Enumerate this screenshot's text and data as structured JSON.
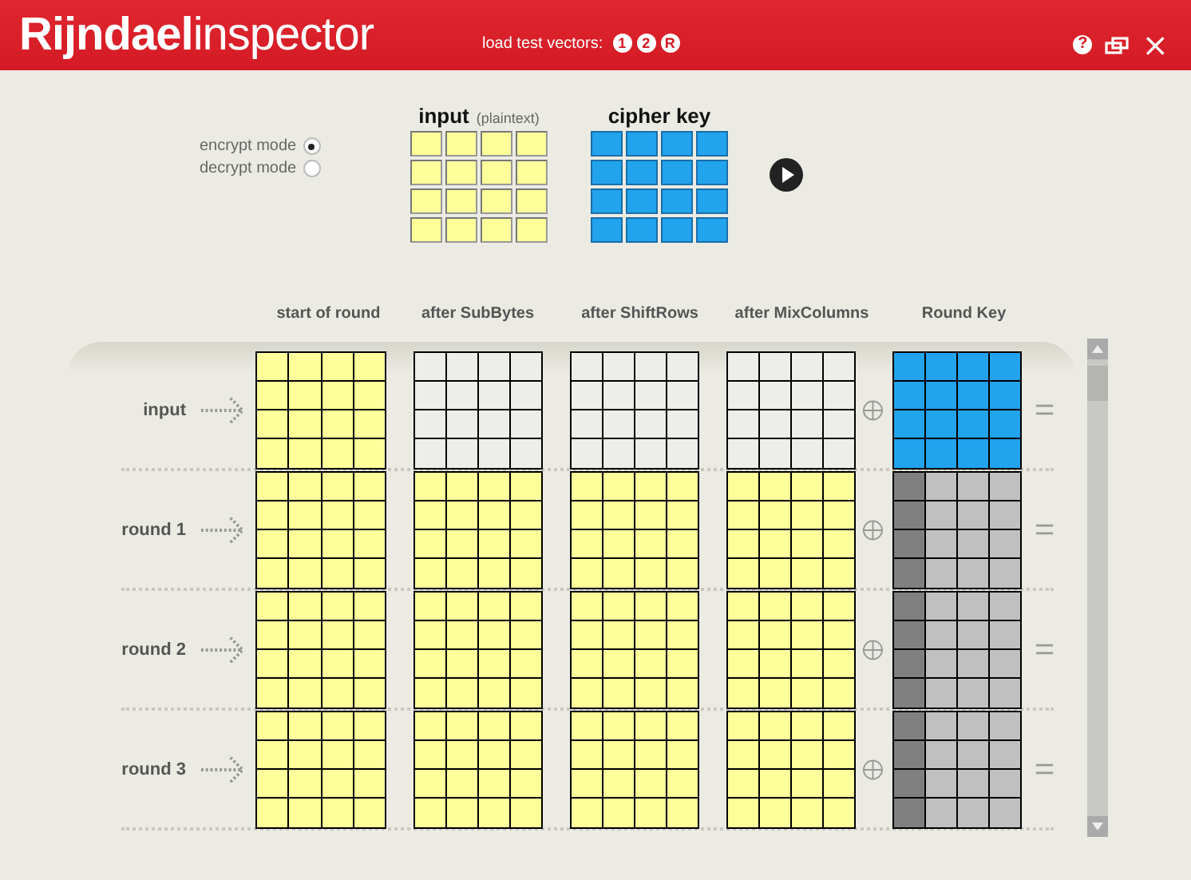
{
  "title": {
    "bold": "Rijndael",
    "light": "inspector"
  },
  "test_vectors": {
    "label": "load test vectors:",
    "buttons": [
      "1",
      "2",
      "R"
    ]
  },
  "window_controls": {
    "help": "?",
    "close": "×"
  },
  "modes": [
    {
      "label": "encrypt mode",
      "selected": true
    },
    {
      "label": "decrypt mode",
      "selected": false
    }
  ],
  "input": {
    "title": "input",
    "hint": "(plaintext)"
  },
  "cipher_key": {
    "title": "cipher key"
  },
  "columns": [
    "start of round",
    "after SubBytes",
    "after ShiftRows",
    "after MixColumns",
    "Round Key"
  ],
  "rounds": [
    {
      "label": "input",
      "states": [
        {
          "kind": "filled"
        },
        {
          "kind": "empty"
        },
        {
          "kind": "empty"
        },
        {
          "kind": "empty"
        }
      ],
      "key": {
        "kind": "cipher"
      }
    },
    {
      "label": "round 1",
      "states": [
        {
          "kind": "filled"
        },
        {
          "kind": "filled"
        },
        {
          "kind": "filled"
        },
        {
          "kind": "filled"
        }
      ],
      "key": {
        "kind": "pending"
      }
    },
    {
      "label": "round 2",
      "states": [
        {
          "kind": "filled"
        },
        {
          "kind": "filled"
        },
        {
          "kind": "filled"
        },
        {
          "kind": "filled"
        }
      ],
      "key": {
        "kind": "pending"
      }
    },
    {
      "label": "round 3",
      "states": [
        {
          "kind": "filled"
        },
        {
          "kind": "filled"
        },
        {
          "kind": "filled"
        },
        {
          "kind": "filled"
        }
      ],
      "key": {
        "kind": "pending"
      }
    }
  ]
}
